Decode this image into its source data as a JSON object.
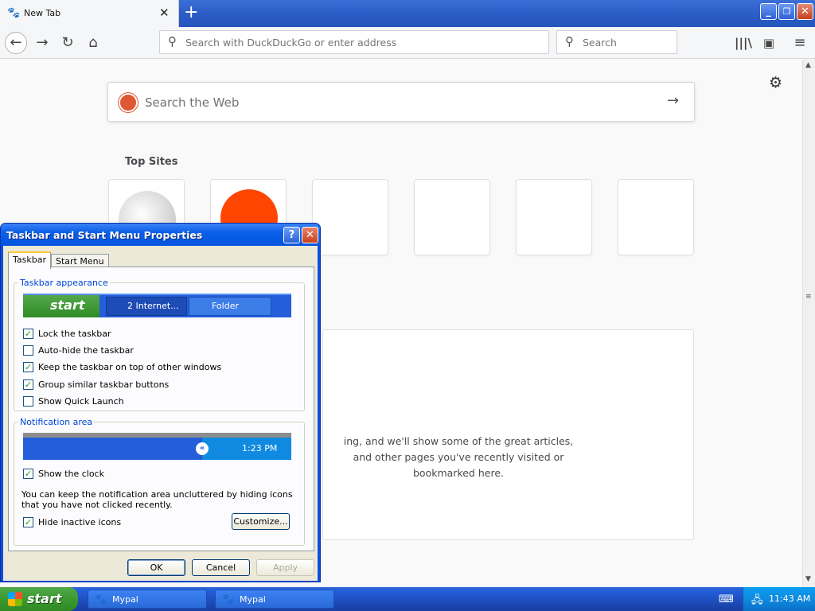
{
  "browser": {
    "tab_title": "New Tab",
    "new_tab_symbol": "+",
    "url_placeholder": "Search with DuckDuckGo or enter address",
    "search_placeholder": "Search",
    "window_buttons": {
      "minimize": "_",
      "restore": "❐",
      "close": "✕"
    }
  },
  "newtab": {
    "web_search_placeholder": "Search the Web",
    "top_sites_title": "Top Sites",
    "highlights_message_lines": [
      "ing, and we'll show some of the great articles,",
      "and other pages you've recently visited or",
      "bookmarked here."
    ]
  },
  "dialog": {
    "title": "Taskbar and Start Menu Properties",
    "help_symbol": "?",
    "close_symbol": "✕",
    "tabs": [
      "Taskbar",
      "Start Menu"
    ],
    "appearance_group": "Taskbar appearance",
    "preview": {
      "start_label": "start",
      "task1": "2 Internet...",
      "task2": "Folder"
    },
    "options": [
      {
        "label": "Lock the taskbar",
        "checked": true
      },
      {
        "label": "Auto-hide the taskbar",
        "checked": false
      },
      {
        "label": "Keep the taskbar on top of other windows",
        "checked": true
      },
      {
        "label": "Group similar taskbar buttons",
        "checked": true
      },
      {
        "label": "Show Quick Launch",
        "checked": false
      }
    ],
    "notification_group": "Notification area",
    "tray_preview_time": "1:23 PM",
    "show_clock": {
      "label": "Show the clock",
      "checked": true
    },
    "description": "You can keep the notification area uncluttered by hiding icons that you have not clicked recently.",
    "hide_inactive": {
      "label": "Hide inactive icons",
      "checked": true
    },
    "customize_button": "Customize...",
    "ok_button": "OK",
    "cancel_button": "Cancel",
    "apply_button": "Apply"
  },
  "taskbar": {
    "start_label": "start",
    "tasks": [
      "Mypal",
      "Mypal"
    ],
    "clock": "11:43 AM"
  },
  "colors": {
    "xp_blue": "#0a4ee0",
    "xp_green": "#3a9a2f",
    "dialog_face": "#ece9d8"
  }
}
